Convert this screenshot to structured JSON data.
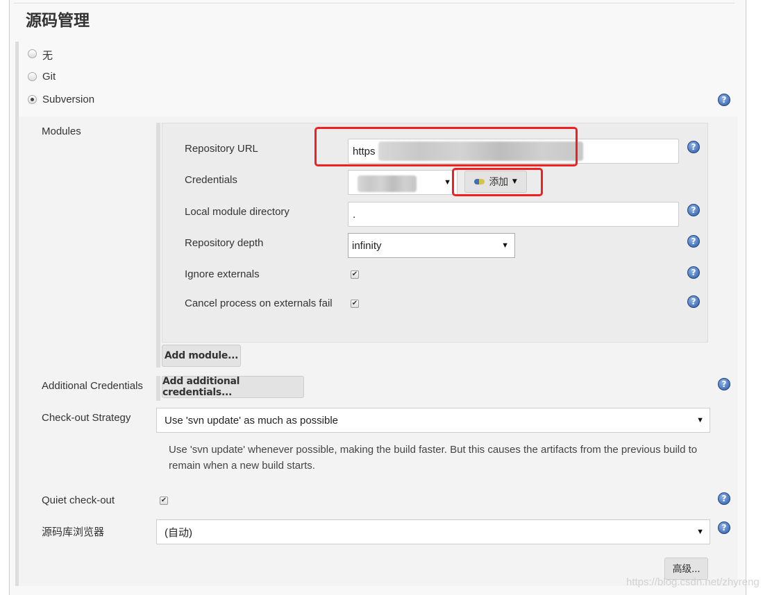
{
  "section_title": "源码管理",
  "scm_options": [
    {
      "label": "无",
      "selected": false
    },
    {
      "label": "Git",
      "selected": false
    },
    {
      "label": "Subversion",
      "selected": true
    }
  ],
  "modules": {
    "label": "Modules",
    "repository_url": {
      "label": "Repository URL",
      "value": "https"
    },
    "credentials": {
      "label": "Credentials",
      "value": "*****",
      "add_button": "添加"
    },
    "local_module_directory": {
      "label": "Local module directory",
      "value": "."
    },
    "repository_depth": {
      "label": "Repository depth",
      "value": "infinity"
    },
    "ignore_externals": {
      "label": "Ignore externals",
      "checked": true
    },
    "cancel_on_externals_fail": {
      "label": "Cancel process on externals fail",
      "checked": true
    },
    "add_module_button": "Add module..."
  },
  "additional_credentials": {
    "label": "Additional Credentials",
    "button": "Add additional credentials..."
  },
  "checkout_strategy": {
    "label": "Check-out Strategy",
    "value": "Use 'svn update' as much as possible",
    "description": "Use 'svn update' whenever possible, making the build faster. But this causes the artifacts from the previous build to remain when a new build starts."
  },
  "quiet_checkout": {
    "label": "Quiet check-out",
    "checked": true
  },
  "repo_browser": {
    "label": "源码库浏览器",
    "value": "(自动)"
  },
  "advanced_button": "高级...",
  "watermark": "https://blog.csdn.net/zhyreng",
  "icons": {
    "help": "help-icon",
    "key": "key-icon",
    "check": "✔",
    "dropdown": "▼"
  },
  "colors": {
    "highlight": "#f02020",
    "help": "#2a5aa8"
  }
}
